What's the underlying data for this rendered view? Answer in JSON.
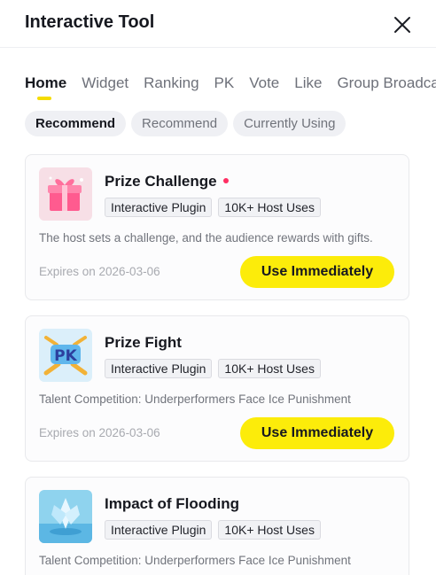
{
  "header": {
    "title": "Interactive Tool"
  },
  "tabs": [
    {
      "label": "Home",
      "active": true
    },
    {
      "label": "Widget"
    },
    {
      "label": "Ranking"
    },
    {
      "label": "PK"
    },
    {
      "label": "Vote"
    },
    {
      "label": "Like"
    },
    {
      "label": "Group Broadcast"
    }
  ],
  "filters": [
    {
      "label": "Recommend",
      "active": true
    },
    {
      "label": "Recommend"
    },
    {
      "label": "Currently Using"
    }
  ],
  "cards": [
    {
      "name": "Prize Challenge",
      "has_new_dot": true,
      "tags": [
        "Interactive Plugin",
        "10K+ Host Uses"
      ],
      "description": "The host sets a challenge, and the audience rewards with gifts.",
      "expiry": "Expires on 2026-03-06",
      "action_label": "Use Immediately",
      "icon": "gift-box-icon"
    },
    {
      "name": "Prize Fight",
      "tags": [
        "Interactive Plugin",
        "10K+ Host Uses"
      ],
      "description": "Talent Competition: Underperformers Face Ice Punishment",
      "expiry": "Expires on 2026-03-06",
      "action_label": "Use Immediately",
      "icon": "pk-badge-icon"
    },
    {
      "name": "Impact of Flooding",
      "tags": [
        "Interactive Plugin",
        "10K+ Host Uses"
      ],
      "description": "Talent Competition: Underperformers Face Ice Punishment",
      "icon": "ice-crystal-icon"
    }
  ],
  "colors": {
    "accent_yellow": "#fcec0a",
    "underline": "#f5dc00",
    "new_dot": "#ff2e63",
    "chip_bg": "#eff0f4"
  }
}
